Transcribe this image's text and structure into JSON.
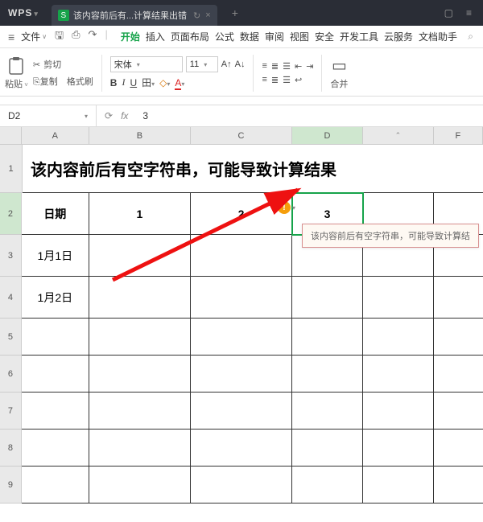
{
  "titlebar": {
    "app": "WPS",
    "tab_badge": "S",
    "tab_title": "该内容前后有...计算结果出错",
    "tab_refresh": "↻",
    "tab_close": "×",
    "new_tab": "+",
    "win_box": "▢",
    "win_menu": "≡"
  },
  "menubar": {
    "file": "文件",
    "items": [
      "开始",
      "插入",
      "页面布局",
      "公式",
      "数据",
      "审阅",
      "视图",
      "安全",
      "开发工具",
      "云服务",
      "文档助手"
    ]
  },
  "ribbon": {
    "paste": "粘贴",
    "cut_icon": "✂",
    "cut": "剪切",
    "copy_icon": "⎘",
    "copy": "复制",
    "format_painter": "格式刷",
    "font_name": "宋体",
    "font_size": "11",
    "A_up": "A↑",
    "A_dn": "A↓",
    "bold": "B",
    "italic": "I",
    "underline": "U",
    "border": "田",
    "fill": "◇",
    "font_color": "A",
    "merge": "合并"
  },
  "formula": {
    "namebox": "D2",
    "reload": "⟳",
    "fx": "fx",
    "value": "3"
  },
  "columns": [
    "A",
    "B",
    "C",
    "D",
    "",
    "F"
  ],
  "col_expand": "⌃",
  "rows": [
    "1",
    "2",
    "3",
    "4",
    "5",
    "6",
    "7",
    "8",
    "9"
  ],
  "cells": {
    "title": "该内容前后有空字符串，可能导致计算结果",
    "r2": {
      "A": "日期",
      "B": "1",
      "C": "2",
      "D": "3"
    },
    "r3": {
      "A": "1月1日"
    },
    "r4": {
      "A": "1月2日"
    }
  },
  "warning": {
    "mark": "!",
    "tooltip": "该内容前后有空字符串，可能导致计算结"
  }
}
